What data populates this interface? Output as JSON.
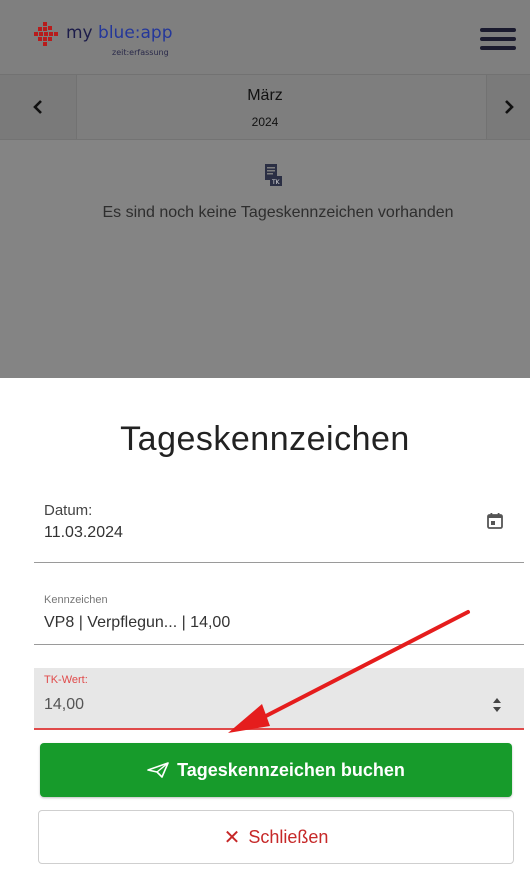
{
  "header": {
    "logo_text_a": "my ",
    "logo_text_b": "blue:app",
    "logo_subtitle": "zeit:erfassung",
    "logo_icon": "grid-logo-icon",
    "menu_icon": "hamburger-menu-icon"
  },
  "month_nav": {
    "prev_icon": "chevron-left-icon",
    "next_icon": "chevron-right-icon",
    "prev_label": "‹",
    "next_label": "›",
    "month": "März",
    "year": "2024"
  },
  "empty_state": {
    "icon": "tk-document-icon",
    "message": "Es sind noch keine Tageskennzeichen vorhanden"
  },
  "form": {
    "title": "Tageskennzeichen",
    "date_label": "Datum:",
    "date_value": "11.03.2024",
    "date_icon": "calendar-icon",
    "kz_label": "Kennzeichen",
    "kz_value": "VP8 | Verpflegun... | 14,00",
    "tk_label": "TK-Wert:",
    "tk_value": "14,00",
    "tk_icon": "spinner-icon"
  },
  "actions": {
    "book_label": "Tageskennzeichen buchen",
    "book_icon": "paper-plane-icon",
    "close_label": "Schließen",
    "close_icon": "close-icon",
    "close_glyph": "✕"
  },
  "colors": {
    "primary_green": "#179b2b",
    "error_red": "#e04a4a",
    "close_red": "#c62828",
    "overlay_gray": "#848484"
  }
}
